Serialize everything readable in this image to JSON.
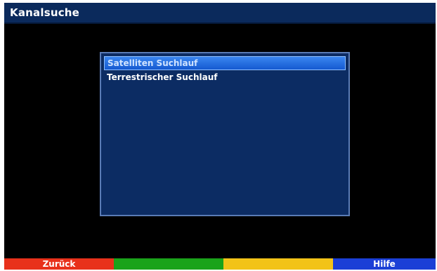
{
  "header": {
    "title": "Kanalsuche"
  },
  "menu": {
    "items": [
      {
        "label": "Satelliten Suchlauf",
        "selected": true
      },
      {
        "label": "Terrestrischer Suchlauf",
        "selected": false
      }
    ]
  },
  "function_keys": {
    "red": {
      "label": "Zurück",
      "color": "#e8311b"
    },
    "green": {
      "label": "",
      "color": "#1aa31a"
    },
    "yellow": {
      "label": "",
      "color": "#f2c318"
    },
    "blue": {
      "label": "Hilfe",
      "color": "#1b3fd6"
    }
  },
  "colors": {
    "title_bar": "#0b2a5c",
    "panel": "#0c2c63",
    "panel_border": "#5a7bb5",
    "selection": "#1f6ae0",
    "background": "#000000"
  }
}
